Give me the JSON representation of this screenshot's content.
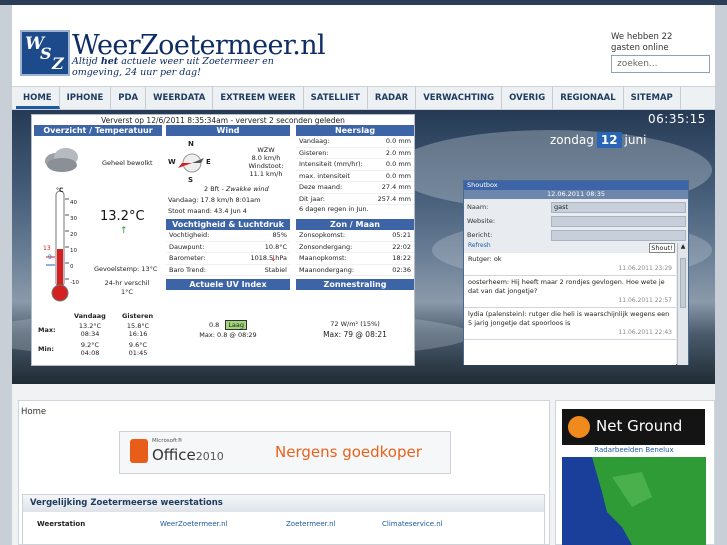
{
  "header": {
    "logo_text": "WSZ",
    "site_title": "WeerZoetermeer.nl",
    "tagline_prefix": "Altijd",
    "tagline_emph": "het",
    "tagline_rest": "actuele weer uit Zoetermeer en omgeving, 24 uur per dag!",
    "guests": "We hebben 22 gasten online",
    "search_placeholder": "zoeken..."
  },
  "nav": [
    "HOME",
    "IPHONE",
    "PDA",
    "WEERDATA",
    "EXTREEM WEER",
    "SATELLIET",
    "RADAR",
    "VERWACHTING",
    "OVERIG",
    "REGIONAAL",
    "SITEMAP"
  ],
  "banner": {
    "clock": "06:35:15",
    "day_name": "zondag",
    "day": "12",
    "month": "juni"
  },
  "weather": {
    "refresh_line": "Ververst op  12/6/2011 8:35:34am - ververst 2 seconden geleden",
    "overview": {
      "title": "Overzicht / Temperatuur",
      "condition": "Geheel bewolkt",
      "temp": "13.2°C",
      "feels": "Gevoelstemp: 13°C",
      "diff_label": "24-hr verschil",
      "diff_value": "1°C",
      "scale": [
        "40",
        "30",
        "20",
        "10",
        "0",
        "-10"
      ],
      "scale_unit": "°C",
      "hi_marker": "13",
      "lo_marker": "9",
      "col_today": "Vandaag",
      "col_yesterday": "Gisteren",
      "max_label": "Max:",
      "min_label": "Min:",
      "max_today": "13.2°C",
      "max_today_time": "08:34",
      "max_yest": "15.8°C",
      "max_yest_time": "16:16",
      "min_today": "9.2°C",
      "min_today_time": "04:08",
      "min_yest": "9.6°C",
      "min_yest_time": "01:45"
    },
    "wind": {
      "title": "Wind",
      "n": "N",
      "e": "E",
      "s": "S",
      "w": "W",
      "dir": "WZW",
      "speed": "8.0 km/h",
      "gust_label": "Windstoot:",
      "gust": "11.1 km/h",
      "bft_num": "2 Bft -",
      "bft_text": "Zwakke wind",
      "today_line": "Vandaag: 17.8 km/h 8:01am",
      "stoot_line": "Stoot maand: 43.4 Jun 4"
    },
    "rain": {
      "title": "Neerslag",
      "rows": [
        [
          "Vandaag:",
          "0.0 mm"
        ],
        [
          "Gisteren:",
          "2.0 mm"
        ],
        [
          "Intensiteit (mm/hr):",
          "0.0 mm"
        ],
        [
          "max. intensiteit",
          "0.0 mm"
        ],
        [
          "Deze maand:",
          "27.4 mm"
        ],
        [
          "Dit jaar:",
          "257.4 mm"
        ]
      ],
      "note": "6 dagen regen in Jun."
    },
    "humidity": {
      "title": "Vochtigheid & Luchtdruk",
      "rows": [
        [
          "Vochtigheid:",
          "85%"
        ],
        [
          "Dauwpunt:",
          "10.8°C"
        ],
        [
          "Barometer:",
          "1018.5 hPa"
        ],
        [
          "Baro Trend:",
          "Stabiel"
        ]
      ]
    },
    "sun": {
      "title": "Zon / Maan",
      "rows": [
        [
          "Zonsopkomst:",
          "05:21"
        ],
        [
          "Zonsondergang:",
          "22:02"
        ],
        [
          "Maanopkomst:",
          "18:22"
        ],
        [
          "Maanondergang:",
          "02:36"
        ]
      ]
    },
    "uv": {
      "title": "Actuele UV Index",
      "value": "0.8",
      "level": "Laag",
      "max": "Max: 0.8 @ 08:29"
    },
    "solar": {
      "title": "Zonnestraling",
      "value": "72 W/m² (15%)",
      "max": "Max: 79 @  08:21"
    }
  },
  "chat": {
    "title": "Shoutbox",
    "date": "12.06.2011 08:35",
    "name_label": "Naam:",
    "name_value": "gast",
    "website_label": "Website:",
    "message_label": "Bericht:",
    "refresh": "Refresh",
    "shout_button": "Shout!",
    "messages": [
      {
        "text": "Rutger: ok",
        "time": "11.06.2011 23:29"
      },
      {
        "text": "oosterheem: Hij heeft maar 2 rondjes gevlogen. Hoe wete je dat van dat jongetje?",
        "time": "11.06.2011 22:57"
      },
      {
        "text": "lydia (palenstein): rutger die heli is waarschijnlijk wegens een 5 jarig jongetje dat spoorloos is",
        "time": "11.06.2011 22:43"
      }
    ]
  },
  "lower": {
    "breadcrumb": "Home",
    "ad_brand_small": "Microsoft®",
    "ad_brand": "Office",
    "ad_year": "2010",
    "ad_text": "Nergens goedkoper",
    "compare_title": "Vergelijking Zoetermeerse weerstations",
    "compare_cols": [
      "Weerstation",
      "WeerZoetermeer.nl",
      "Zoetermeer.nl",
      "Climateservice.nl"
    ],
    "ng_text": "Net Ground",
    "radar_title": "Radarbeelden Benelux"
  },
  "colors": {
    "accent": "#3e64a8",
    "title": "#0d2d63",
    "ng_orange": "#f08a1c"
  }
}
